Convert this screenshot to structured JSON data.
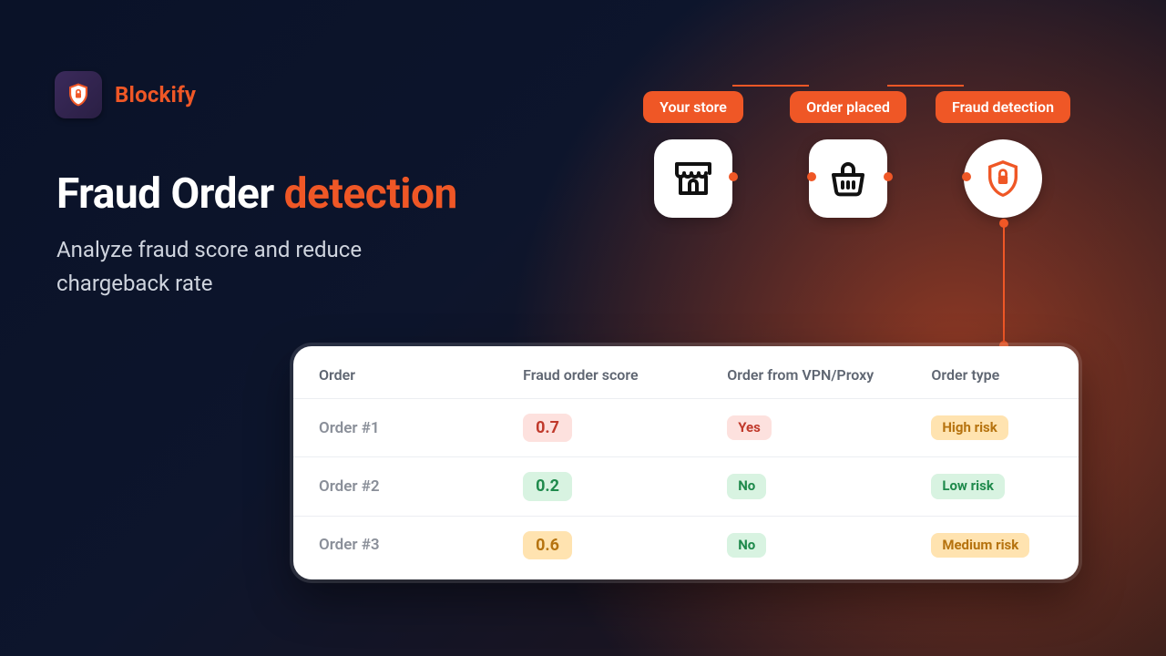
{
  "brand": {
    "name": "Blockify"
  },
  "headline": {
    "part1": "Fraud Order ",
    "part2": "detection"
  },
  "subhead": "Analyze fraud score and reduce chargeback rate",
  "flow": {
    "steps": [
      {
        "label": "Your store"
      },
      {
        "label": "Order placed"
      },
      {
        "label": "Fraud detection"
      }
    ]
  },
  "table": {
    "headers": {
      "order": "Order",
      "score": "Fraud order score",
      "vpn": "Order from VPN/Proxy",
      "type": "Order type"
    },
    "rows": [
      {
        "order": "Order #1",
        "score": "0.7",
        "score_tone": "red",
        "vpn": "Yes",
        "vpn_tone": "red",
        "type": "High risk",
        "type_tone": "amber"
      },
      {
        "order": "Order #2",
        "score": "0.2",
        "score_tone": "green",
        "vpn": "No",
        "vpn_tone": "green",
        "type": "Low risk",
        "type_tone": "green"
      },
      {
        "order": "Order #3",
        "score": "0.6",
        "score_tone": "amber",
        "vpn": "No",
        "vpn_tone": "green",
        "type": "Medium risk",
        "type_tone": "amber"
      }
    ]
  },
  "colors": {
    "accent": "#ef5726"
  }
}
